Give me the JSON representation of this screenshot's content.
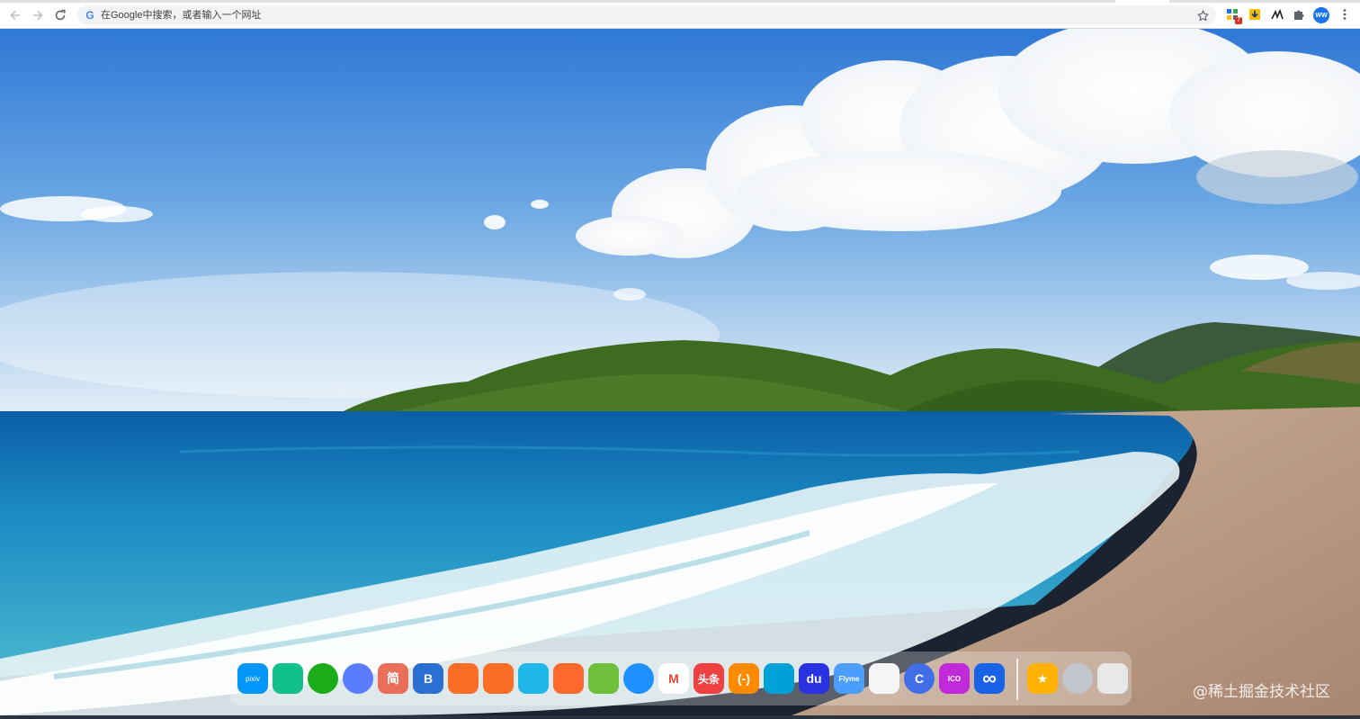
{
  "browser": {
    "omnibox_placeholder": "在Google中搜索，或者输入一个网址",
    "extension_badge_count": "7",
    "avatar_initials": "WW"
  },
  "dock": {
    "apps": [
      {
        "name": "pixiv",
        "label": "pixiv",
        "color": "#0096fa"
      },
      {
        "name": "video-play",
        "label": "",
        "color": "#12c08a"
      },
      {
        "name": "wechat",
        "label": "",
        "color": "#1aad19"
      },
      {
        "name": "qq",
        "label": "",
        "color": "#5a7cff"
      },
      {
        "name": "jianshu",
        "label": "简",
        "color": "#ea6f5a"
      },
      {
        "name": "bootstrap",
        "label": "B",
        "color": "#2a6fd1"
      },
      {
        "name": "gitlab",
        "label": "",
        "color": "#fc6d26"
      },
      {
        "name": "gitlab-2",
        "label": "",
        "color": "#fc6d26"
      },
      {
        "name": "hexagon-app",
        "label": "",
        "color": "#1fb6e8"
      },
      {
        "name": "audio-app",
        "label": "",
        "color": "#ff6a2c"
      },
      {
        "name": "sunflower-app",
        "label": "",
        "color": "#6fbf3a"
      },
      {
        "name": "circle-app",
        "label": "",
        "color": "#1e90ff"
      },
      {
        "name": "gmail",
        "label": "M",
        "color": "#ffffff"
      },
      {
        "name": "toutiao",
        "label": "头条",
        "color": "#f04142"
      },
      {
        "name": "code-app",
        "label": "(-)",
        "color": "#ff8a00"
      },
      {
        "name": "bilibili",
        "label": "",
        "color": "#00a1d6"
      },
      {
        "name": "baidu",
        "label": "du",
        "color": "#2932e1"
      },
      {
        "name": "flyme",
        "label": "Flyme",
        "color": "#4a9eff"
      },
      {
        "name": "notes",
        "label": "",
        "color": "#f5f5f5"
      },
      {
        "name": "c-app",
        "label": "C",
        "color": "#3f6ee8"
      },
      {
        "name": "icourse",
        "label": "ICO",
        "color": "#c02ad8"
      },
      {
        "name": "infinity",
        "label": "∞",
        "color": "#1762e6"
      },
      {
        "name": "favorites",
        "label": "★",
        "color": "#ffb300"
      },
      {
        "name": "launchpad",
        "label": "",
        "color": "#c0c6cc"
      },
      {
        "name": "trash",
        "label": "",
        "color": "#e8e8e8"
      }
    ]
  },
  "watermark": "@稀土掘金技术社区"
}
